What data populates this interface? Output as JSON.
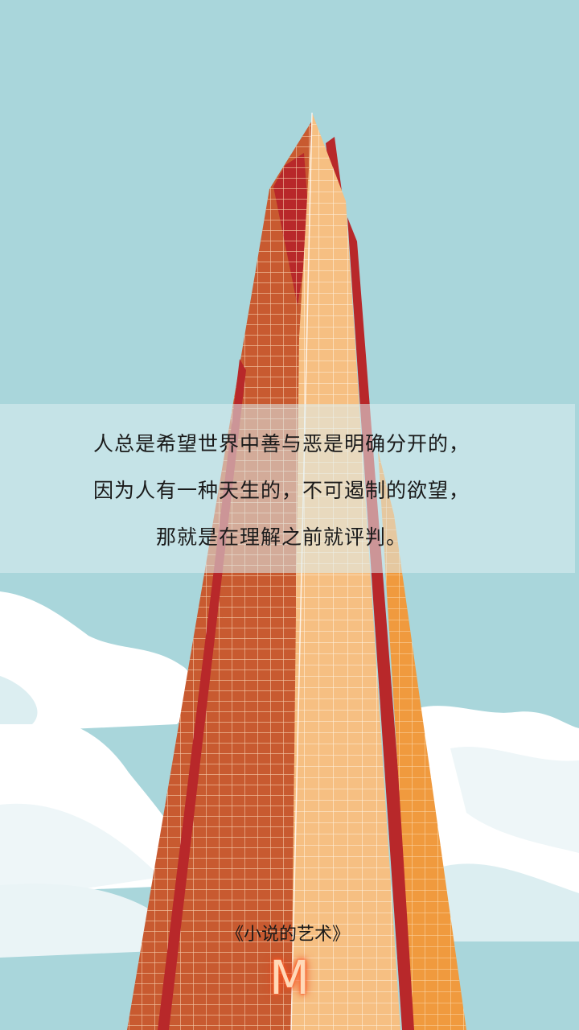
{
  "quote": {
    "lines": [
      "人总是希望世界中善与恶是明确分开的，",
      "因为人有一种天生的，不可遏制的欲望，",
      "那就是在理解之前就评判。"
    ]
  },
  "book_title": "《小说的艺术》",
  "logo_letter": "M",
  "colors": {
    "sky": "#a9d6db",
    "cloud": "#ffffff",
    "tower_left": "#c85a30",
    "tower_center": "#f6bf82",
    "tower_right": "#f09a3e",
    "tower_accent_red": "#b8282a",
    "logo_glow": "#ff6a2a"
  }
}
